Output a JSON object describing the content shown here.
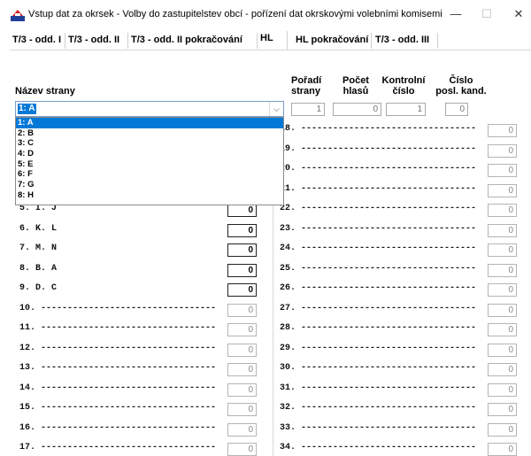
{
  "window": {
    "title": "Vstup dat za okrsek - Volby do zastupitelstev obcí - pořízení dat okrskovými volebními komisemi",
    "minimize": "—",
    "maximize": "☐",
    "close": "✕"
  },
  "tabs": [
    {
      "label": "T/3 - odd. I"
    },
    {
      "label": "T/3 - odd. II"
    },
    {
      "label": "T/3 - odd. II pokračování"
    },
    {
      "label": "HL"
    },
    {
      "label": "HL pokračování"
    },
    {
      "label": "T/3 - odd. III"
    }
  ],
  "header": {
    "party_name_label": "Název strany",
    "order_label_1": "Pořadí",
    "order_label_2": "strany",
    "votes_label_1": "Počet",
    "votes_label_2": "hlasů",
    "control_label_1": "Kontrolní",
    "control_label_2": "číslo",
    "lastcand_label_1": "Číslo",
    "lastcand_label_2": "posl. kand."
  },
  "party_select": {
    "selected": "1: A",
    "options": [
      "1: A",
      "2: B",
      "3: C",
      "4: D",
      "5: E",
      "6: F",
      "7: G",
      "8: H"
    ]
  },
  "summary": {
    "order": "1",
    "votes": "0",
    "control": "1",
    "last_candidate": "0"
  },
  "left_rows": [
    {
      "label": "5. I. J",
      "value": "0",
      "enabled": true
    },
    {
      "label": "6. K. L",
      "value": "0",
      "enabled": true
    },
    {
      "label": "7. M. N",
      "value": "0",
      "enabled": true
    },
    {
      "label": "8. B. A",
      "value": "0",
      "enabled": true
    },
    {
      "label": "9. D. C",
      "value": "0",
      "enabled": true
    },
    {
      "label": "10. ---------------------------------",
      "value": "0",
      "enabled": false
    },
    {
      "label": "11. ---------------------------------",
      "value": "0",
      "enabled": false
    },
    {
      "label": "12. ---------------------------------",
      "value": "0",
      "enabled": false
    },
    {
      "label": "13. ---------------------------------",
      "value": "0",
      "enabled": false
    },
    {
      "label": "14. ---------------------------------",
      "value": "0",
      "enabled": false
    },
    {
      "label": "15. ---------------------------------",
      "value": "0",
      "enabled": false
    },
    {
      "label": "16. ---------------------------------",
      "value": "0",
      "enabled": false
    },
    {
      "label": "17. ---------------------------------",
      "value": "0",
      "enabled": false
    }
  ],
  "right_rows": [
    {
      "label": "18. ---------------------------------",
      "value": "0"
    },
    {
      "label": "19. ---------------------------------",
      "value": "0"
    },
    {
      "label": "20. ---------------------------------",
      "value": "0"
    },
    {
      "label": "21. ---------------------------------",
      "value": "0"
    },
    {
      "label": "22. ---------------------------------",
      "value": "0"
    },
    {
      "label": "23. ---------------------------------",
      "value": "0"
    },
    {
      "label": "24. ---------------------------------",
      "value": "0"
    },
    {
      "label": "25. ---------------------------------",
      "value": "0"
    },
    {
      "label": "26. ---------------------------------",
      "value": "0"
    },
    {
      "label": "27. ---------------------------------",
      "value": "0"
    },
    {
      "label": "28. ---------------------------------",
      "value": "0"
    },
    {
      "label": "29. ---------------------------------",
      "value": "0"
    },
    {
      "label": "30. ---------------------------------",
      "value": "0"
    },
    {
      "label": "31. ---------------------------------",
      "value": "0"
    },
    {
      "label": "32. ---------------------------------",
      "value": "0"
    },
    {
      "label": "33. ---------------------------------",
      "value": "0"
    },
    {
      "label": "34. ---------------------------------",
      "value": "0"
    }
  ]
}
